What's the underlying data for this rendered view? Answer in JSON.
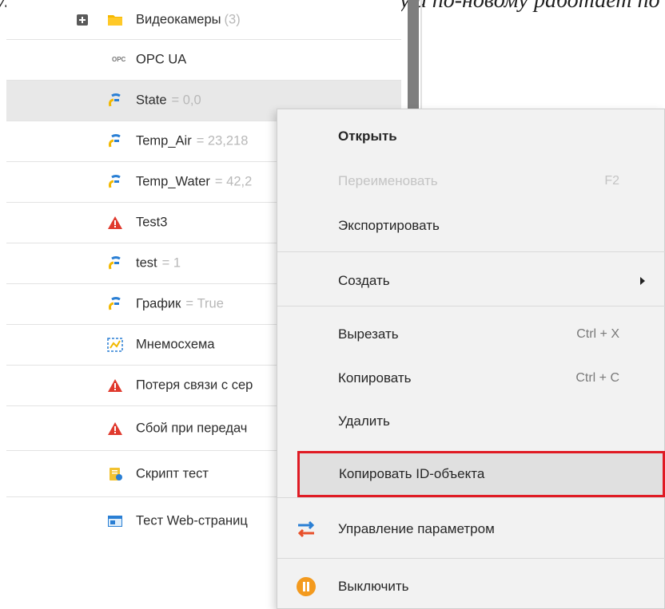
{
  "caption": "уже по-другому, а по-другому - по-старому и по-новому работает по",
  "tree": {
    "rows": [
      {
        "label": "Видеокамеры",
        "count": "(3)",
        "value": "",
        "icon": "folder-icon"
      },
      {
        "label": "OPC UA",
        "count": "",
        "value": "",
        "icon": "opc-icon",
        "icon_text": "OPC"
      },
      {
        "label": "State",
        "count": "",
        "value": "= 0,0",
        "icon": "tag-icon"
      },
      {
        "label": "Temp_Air",
        "count": "",
        "value": "= 23,218",
        "icon": "tag-icon"
      },
      {
        "label": "Temp_Water",
        "count": "",
        "value": "= 42,2",
        "icon": "tag-icon"
      },
      {
        "label": "Test3",
        "count": "",
        "value": "",
        "icon": "alarm-icon"
      },
      {
        "label": "test",
        "count": "",
        "value": "= 1",
        "icon": "tag-icon"
      },
      {
        "label": "График",
        "count": "",
        "value": "= True",
        "icon": "tag-icon"
      },
      {
        "label": "Мнемосхема",
        "count": "",
        "value": "",
        "icon": "mnemo-icon"
      },
      {
        "label": "Потеря связи с сер",
        "count": "",
        "value": "",
        "icon": "alarm-icon"
      },
      {
        "label": "Сбой при передач",
        "count": "",
        "value": "",
        "icon": "alarm-icon"
      },
      {
        "label": "Скрипт тест",
        "count": "",
        "value": "",
        "icon": "script-icon"
      },
      {
        "label": "Тест Web-страниц",
        "count": "",
        "value": "",
        "icon": "webpage-icon"
      }
    ]
  },
  "context_menu": {
    "items": [
      {
        "label": "Открыть",
        "shortcut": "",
        "state": "bold"
      },
      {
        "label": "Переименовать",
        "shortcut": "F2",
        "state": "disabled"
      },
      {
        "label": "Экспортировать",
        "shortcut": "",
        "state": "normal"
      },
      {
        "label": "Создать",
        "shortcut": "",
        "state": "submenu"
      },
      {
        "label": "Вырезать",
        "shortcut": "Ctrl + X",
        "state": "normal"
      },
      {
        "label": "Копировать",
        "shortcut": "Ctrl + C",
        "state": "normal"
      },
      {
        "label": "Удалить",
        "shortcut": "",
        "state": "normal"
      },
      {
        "label": "Копировать ID-объекта",
        "shortcut": "",
        "state": "highlighted"
      },
      {
        "label": "Управление параметром",
        "shortcut": "",
        "state": "normal",
        "icon": "swap-arrows-icon"
      },
      {
        "label": "Выключить",
        "shortcut": "",
        "state": "normal",
        "icon": "pause-icon"
      }
    ]
  },
  "colors": {
    "highlight_border": "#e01b24",
    "alarm": "#e03a2e",
    "tag_blue": "#2a7fd4",
    "tag_yellow": "#f2b800",
    "pause_orange": "#f39a1e"
  }
}
